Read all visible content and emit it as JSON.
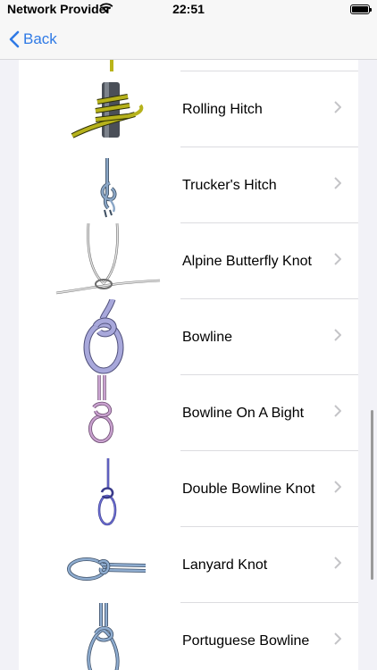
{
  "status": {
    "carrier": "Network Provider",
    "time": "22:51"
  },
  "nav": {
    "back_label": "Back"
  },
  "knots": [
    {
      "name": "Rolling Hitch"
    },
    {
      "name": "Trucker's Hitch"
    },
    {
      "name": "Alpine Butterfly Knot"
    },
    {
      "name": "Bowline"
    },
    {
      "name": "Bowline On A Bight"
    },
    {
      "name": "Double Bowline Knot"
    },
    {
      "name": "Lanyard Knot"
    },
    {
      "name": "Portuguese Bowline"
    }
  ],
  "colors": {
    "accent": "#2f7ae5"
  },
  "icons": {
    "back": "chevron-left-icon",
    "disclosure": "chevron-right-icon"
  }
}
